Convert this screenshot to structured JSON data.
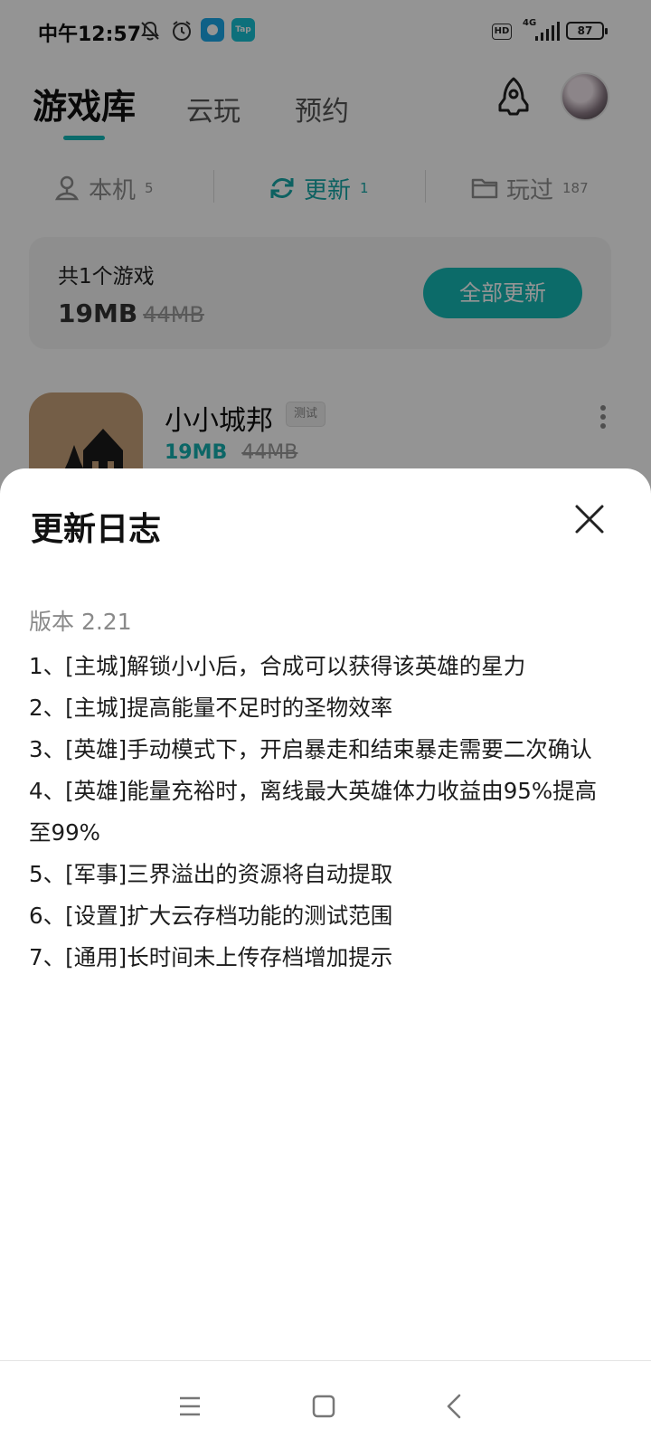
{
  "status_bar": {
    "time": "中午12:57",
    "hd": "HD",
    "network": "4G",
    "battery": "87",
    "app_icons": [
      "mute-icon",
      "alarm-icon",
      "chat-app-icon",
      "tap-app-icon"
    ],
    "tap_label": "Tap"
  },
  "header": {
    "tabs": [
      {
        "label": "游戏库",
        "active": true
      },
      {
        "label": "云玩",
        "active": false
      },
      {
        "label": "预约",
        "active": false
      }
    ]
  },
  "sub_tabs": [
    {
      "label": "本机",
      "count": "5",
      "icon": "local-device-icon"
    },
    {
      "label": "更新",
      "count": "1",
      "icon": "refresh-icon",
      "active": true
    },
    {
      "label": "玩过",
      "count": "187",
      "icon": "folder-icon"
    }
  ],
  "summary": {
    "title": "共1个游戏",
    "size": "19MB",
    "old_size": "44MB",
    "update_all": "全部更新"
  },
  "game": {
    "name": "小小城邦",
    "badge": "测试",
    "size": "19MB",
    "old_size": "44MB"
  },
  "sheet": {
    "title": "更新日志",
    "version": "版本 2.21",
    "items": [
      "1、[主城]解锁小小后，合成可以获得该英雄的星力",
      "2、[主城]提高能量不足时的圣物效率",
      "3、[英雄]手动模式下，开启暴走和结束暴走需要二次确认",
      "4、[英雄]能量充裕时，离线最大英雄体力收益由95%提高至99%",
      "5、[军事]三界溢出的资源将自动提取",
      "6、[设置]扩大云存档功能的测试范围",
      "7、[通用]长时间未上传存档增加提示"
    ]
  },
  "colors": {
    "accent": "#16b9b6",
    "overlay": "rgba(0,0,0,0.42)"
  }
}
